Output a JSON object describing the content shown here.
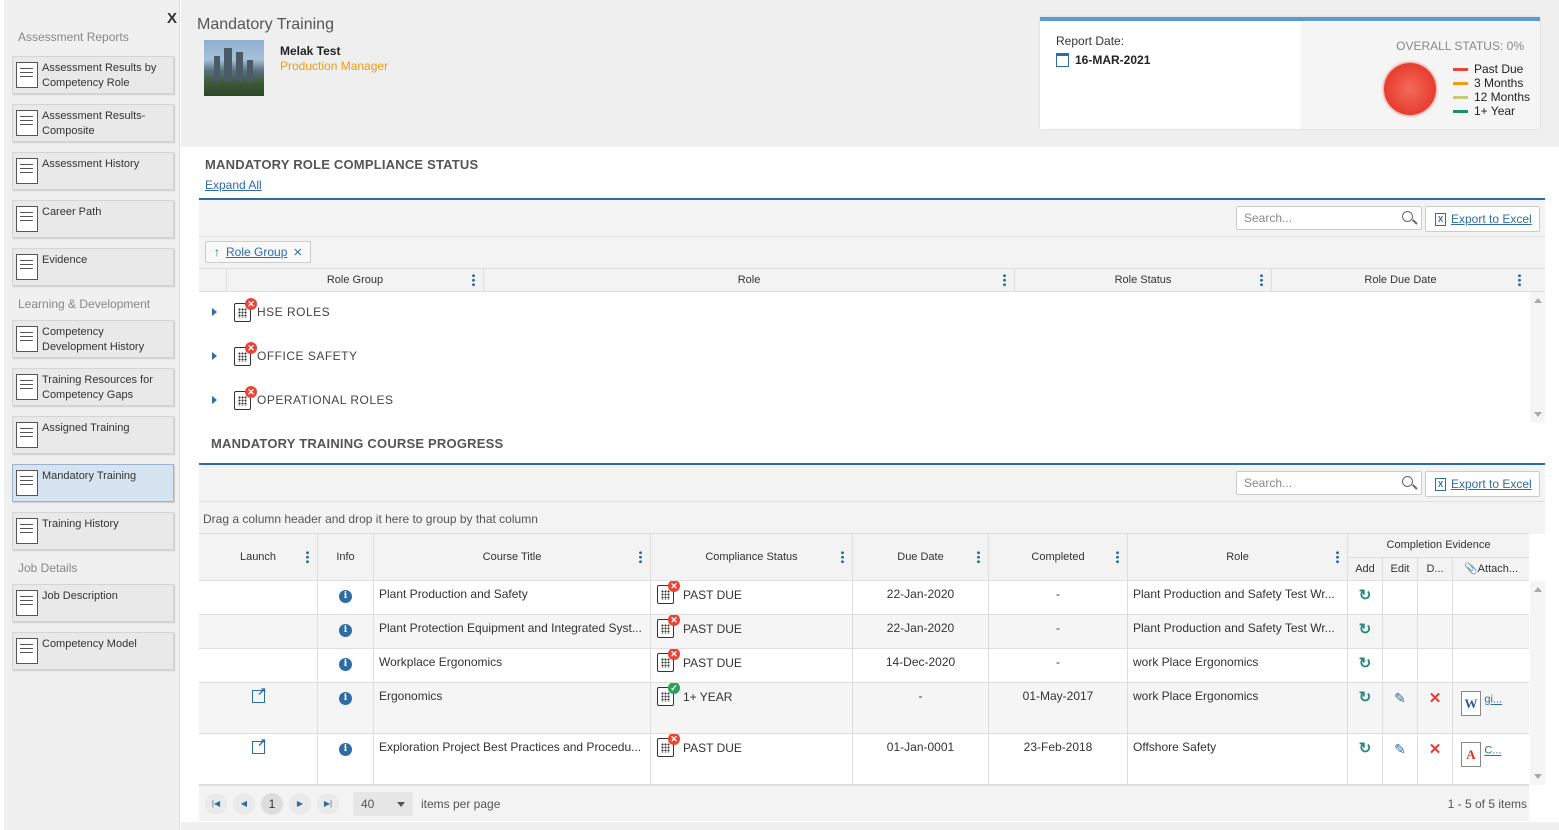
{
  "sidebar": {
    "close": "X",
    "sections": [
      {
        "title": "Assessment Reports",
        "items": [
          "Assessment Results by Competency Role",
          "Assessment Results-Composite",
          "Assessment History",
          "Career Path",
          "Evidence"
        ]
      },
      {
        "title": "Learning & Development",
        "items": [
          "Competency Development History",
          "Training Resources for Competency Gaps",
          "Assigned Training",
          "Mandatory Training",
          "Training History"
        ]
      },
      {
        "title": "Job Details",
        "items": [
          "Job Description",
          "Competency Model"
        ]
      }
    ]
  },
  "header": {
    "title": "Mandatory Training",
    "employee_name": "Melak Test",
    "employee_role": "Production Manager",
    "report_date_label": "Report Date:",
    "report_date": "16-MAR-2021",
    "overall_status": "OVERALL STATUS: 0%",
    "status_color": "#e94335",
    "legend": [
      {
        "label": "Past Due",
        "color": "#e94335"
      },
      {
        "label": "3 Months",
        "color": "#f39c12"
      },
      {
        "label": "12 Months",
        "color": "#c8c87a"
      },
      {
        "label": "1+ Year",
        "color": "#1a8f6a"
      }
    ]
  },
  "role_compliance": {
    "title": "MANDATORY ROLE COMPLIANCE STATUS",
    "expand_all": "Expand All",
    "search_placeholder": "Search...",
    "export_label": "Export to Excel",
    "group_chip": "Role Group",
    "group_chip_remove": "×",
    "columns": [
      "Role Group",
      "Role",
      "Role Status",
      "Role Due Date"
    ],
    "groups": [
      "HSE ROLES",
      "OFFICE SAFETY",
      "OPERATIONAL ROLES"
    ]
  },
  "course_progress": {
    "title": "MANDATORY TRAINING COURSE PROGRESS",
    "search_placeholder": "Search...",
    "export_label": "Export to Excel",
    "group_hint": "Drag a column header and drop it here to group by that column",
    "columns": {
      "launch": "Launch",
      "info": "Info",
      "course_title": "Course Title",
      "compliance_status": "Compliance Status",
      "due_date": "Due Date",
      "completed": "Completed",
      "role": "Role",
      "evidence": "Completion Evidence",
      "add": "Add",
      "edit": "Edit",
      "delete": "D...",
      "attach": "Attach..."
    },
    "rows": [
      {
        "title": "Plant Production and Safety",
        "status": "PAST DUE",
        "due": "22-Jan-2020",
        "completed": "-",
        "role": "Plant Production and Safety Test Wr...",
        "launch": false,
        "edit": false,
        "attach": ""
      },
      {
        "title": "Plant Protection Equipment and Integrated Syst...",
        "status": "PAST DUE",
        "due": "22-Jan-2020",
        "completed": "-",
        "role": "Plant Production and Safety Test Wr...",
        "launch": false,
        "edit": false,
        "attach": ""
      },
      {
        "title": "Workplace Ergonomics",
        "status": "PAST DUE",
        "due": "14-Dec-2020",
        "completed": "-",
        "role": "work Place Ergonomics",
        "launch": false,
        "edit": false,
        "attach": ""
      },
      {
        "title": "Ergonomics",
        "status": "1+ YEAR",
        "due": "-",
        "completed": "01-May-2017",
        "role": "work Place Ergonomics",
        "launch": true,
        "edit": true,
        "attach": "gi...",
        "attach_type": "word"
      },
      {
        "title": "Exploration Project Best Practices and Procedu...",
        "status": "PAST DUE",
        "due": "01-Jan-0001",
        "completed": "23-Feb-2018",
        "role": "Offshore Safety",
        "launch": true,
        "edit": true,
        "attach": "C...",
        "attach_type": "pdf"
      }
    ],
    "pager": {
      "page": "1",
      "page_size": "40",
      "items_per_page": "items per page",
      "summary": "1 - 5 of 5 items"
    }
  }
}
